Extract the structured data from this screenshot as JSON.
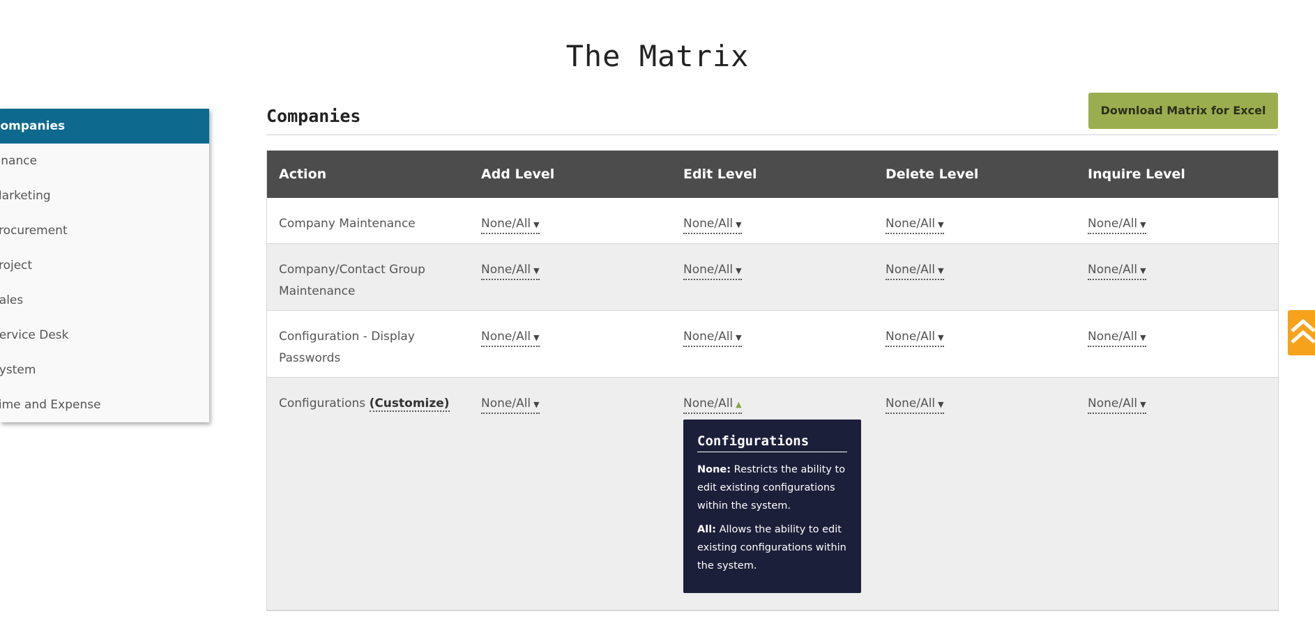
{
  "page": {
    "title": "The Matrix"
  },
  "sidebar": {
    "items": [
      {
        "label": "Companies",
        "active": true
      },
      {
        "label": "Finance"
      },
      {
        "label": "Marketing"
      },
      {
        "label": "Procurement"
      },
      {
        "label": "Project"
      },
      {
        "label": "Sales"
      },
      {
        "label": "Service Desk"
      },
      {
        "label": "System"
      },
      {
        "label": "Time and Expense"
      }
    ]
  },
  "section": {
    "title": "Companies",
    "download_label": "Download Matrix for Excel"
  },
  "table": {
    "headers": [
      "Action",
      "Add Level",
      "Edit Level",
      "Delete Level",
      "Inquire Level"
    ],
    "rows": [
      {
        "action": "Company Maintenance",
        "levels": [
          "None/All",
          "None/All",
          "None/All",
          "None/All"
        ]
      },
      {
        "action": "Company/Contact Group Maintenance",
        "levels": [
          "None/All",
          "None/All",
          "None/All",
          "None/All"
        ]
      },
      {
        "action": "Configuration - Display Passwords",
        "levels": [
          "None/All",
          "None/All",
          "None/All",
          "None/All"
        ]
      },
      {
        "action": "Configurations",
        "customize": "(Customize)",
        "levels": [
          "None/All",
          "None/All",
          "None/All",
          "None/All"
        ]
      }
    ]
  },
  "tooltip": {
    "title": "Configurations",
    "none_label": "None:",
    "none_text": "Restricts the ability to edit existing configurations within the system.",
    "all_label": "All:",
    "all_text": "Allows the ability to edit existing configurations within the system."
  },
  "colors": {
    "sidebar_active": "#0d6a8e",
    "header": "#4c4c4c",
    "download": "#9aae4f",
    "tooltip": "#1c1f3a",
    "scroll_top": "#f7a21b"
  },
  "icons": {
    "dropdown": "chevron-down-icon",
    "dropdown_open": "chevron-up-icon",
    "scroll_top": "double-chevron-up-icon"
  }
}
